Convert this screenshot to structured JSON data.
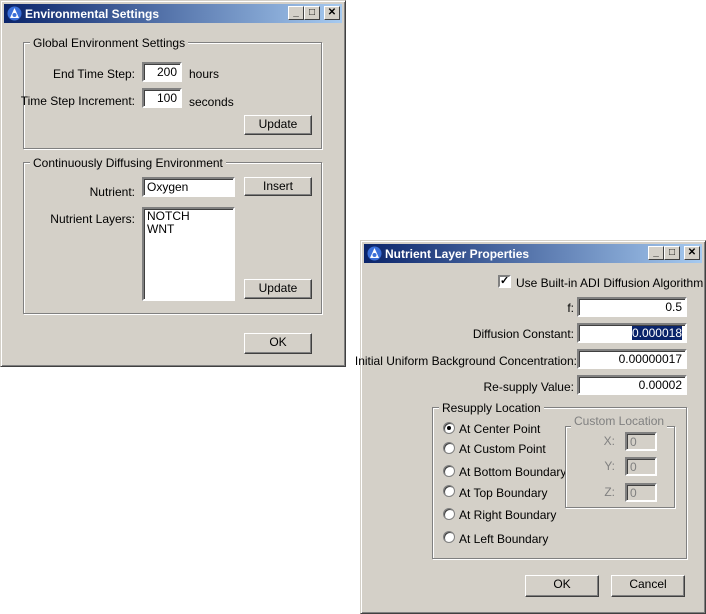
{
  "env_window": {
    "title": "Environmental Settings",
    "title_buttons": [
      "_",
      "□",
      "✕"
    ],
    "global_group": {
      "legend": "Global Environment Settings",
      "end_time_label": "End Time Step:",
      "end_time_value": "200",
      "end_time_unit": "hours",
      "increment_label": "Time Step Increment:",
      "increment_value": "100",
      "increment_unit": "seconds",
      "update_label": "Update"
    },
    "diffusing_group": {
      "legend": "Continuously Diffusing Environment",
      "nutrient_label": "Nutrient:",
      "nutrient_value": "Oxygen",
      "insert_label": "Insert",
      "layers_label": "Nutrient Layers:",
      "layers": [
        "NOTCH",
        "WNT"
      ],
      "update_label": "Update"
    },
    "ok_label": "OK"
  },
  "nutrient_window": {
    "title": "Nutrient Layer Properties",
    "title_buttons": [
      "_",
      "□",
      "✕"
    ],
    "adi_label": "Use Built-in ADI Diffusion Algorithm",
    "adi_checked": true,
    "f_label": "f:",
    "f_value": "0.5",
    "diffusion_label": "Diffusion Constant:",
    "diffusion_value": "0.000018",
    "initial_label": "Initial Uniform Background Concentration:",
    "initial_value": "0.00000017",
    "resupply_label": "Re-supply Value:",
    "resupply_value": "0.00002",
    "location_group": {
      "legend": "Resupply Location",
      "options": [
        "At Center Point",
        "At Custom Point",
        "At Bottom Boundary",
        "At Top Boundary",
        "At Right Boundary",
        "At Left Boundary"
      ],
      "selected": "At Center Point",
      "custom": {
        "legend": "Custom Location",
        "x_label": "X:",
        "x_value": "0",
        "y_label": "Y:",
        "y_value": "0",
        "z_label": "Z:",
        "z_value": "0"
      }
    },
    "ok_label": "OK",
    "cancel_label": "Cancel"
  },
  "colors": {
    "face": "#d4d0c8",
    "title_active": "#0a246a",
    "title_gradient_end": "#a6caf0",
    "selection": "#0a246a"
  }
}
